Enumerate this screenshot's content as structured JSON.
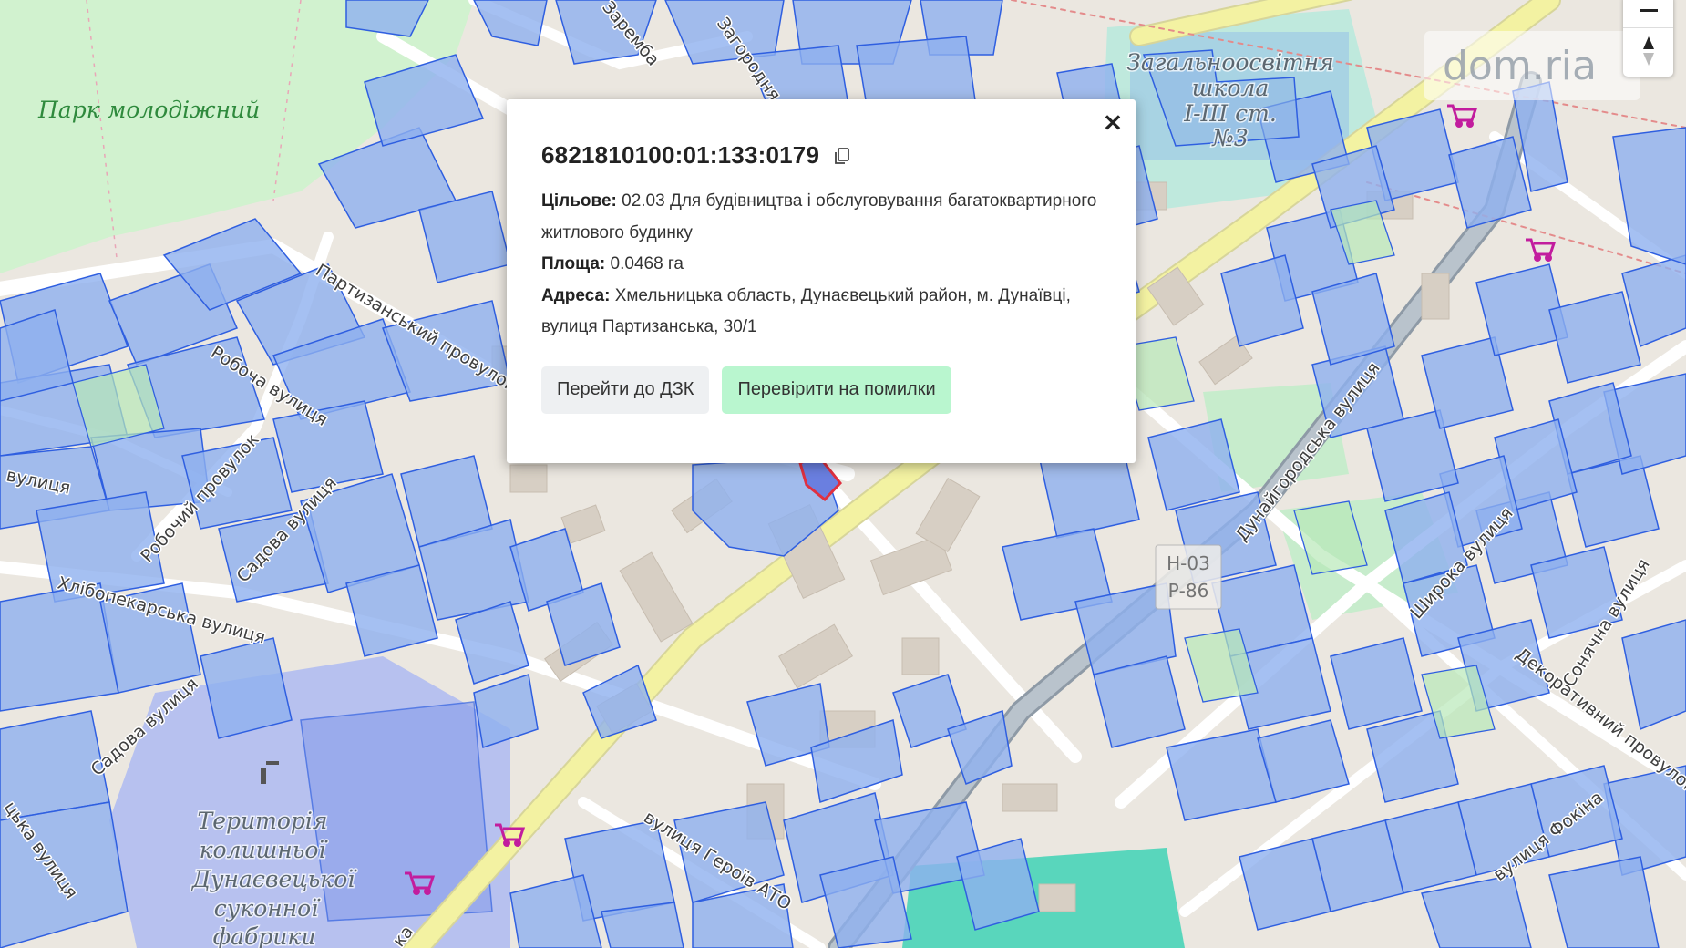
{
  "map": {
    "park_label": "Парк молодіжний",
    "school_label": [
      "Загальноосвітня",
      "школа",
      "I-III ст.",
      "№3"
    ],
    "factory_label": [
      "Територія",
      "колишньої",
      "Дунаєвецької",
      "суконної",
      "фабрики"
    ],
    "road_shields": [
      "Н-03",
      "Р-86"
    ],
    "streets": [
      "Партизанський провулок",
      "Робоча вулиця",
      "Робочий провулок",
      "Садова вулиця",
      "Садова вулиця",
      "Хлібопекарська вулиця",
      "вулиця",
      "Дунайгородська вулиця",
      "Широка вулиця",
      "Сонячна вулиця",
      "Декоративний провулок",
      "вулиця Фокіна",
      "вулиця Героїв АТО",
      "Загородня",
      "Заремба",
      "цька вулиця",
      "ка"
    ]
  },
  "popup": {
    "cadastral_number": "6821810100:01:133:0179",
    "purpose_label": "Цільове:",
    "purpose_value": "02.03 Для будівництва і обслуговування багатоквартирного житлового будинку",
    "area_label": "Площа:",
    "area_value": "0.0468 га",
    "address_label": "Адреса:",
    "address_value": "Хмельницька область, Дунаєвецький район, м. Дунаївці, вулиця Партизанська, 30/1",
    "button_dzk": "Перейти до ДЗК",
    "button_check": "Перевірити на помилки",
    "close": "×"
  },
  "watermark": "dom.ria",
  "colors": {
    "parcel_fill": "#8fb0ef",
    "parcel_stroke": "#2f5fe0",
    "park": "#d1f2cf",
    "road_main": "#f3f2a2",
    "selected_parcel": "#e03040",
    "shop_icon": "#c21d9e",
    "ag_parcel": "#b8e8b8"
  },
  "icons": [
    "copy-icon",
    "close-icon",
    "shopping-cart-icon",
    "compass-icon",
    "zoom-out-icon",
    "building-icon"
  ]
}
